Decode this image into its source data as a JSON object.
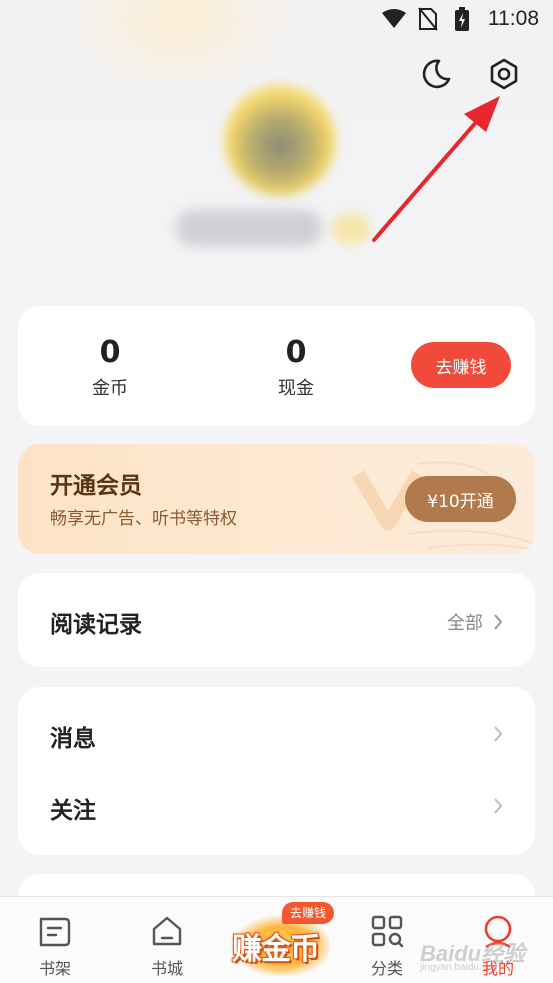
{
  "status_bar": {
    "time": "11:08"
  },
  "wallet": {
    "coins_value": "0",
    "coins_label": "金币",
    "cash_value": "0",
    "cash_label": "现金",
    "earn_button": "去赚钱"
  },
  "vip": {
    "title": "开通会员",
    "subtitle": "畅享无广告、听书等特权",
    "button": "¥10开通"
  },
  "reading": {
    "title": "阅读记录",
    "all_label": "全部"
  },
  "menu": {
    "items": [
      {
        "label": "消息"
      },
      {
        "label": "关注"
      }
    ]
  },
  "bottom_nav": {
    "items": [
      {
        "label": "书架",
        "icon": "bookshelf-icon"
      },
      {
        "label": "书城",
        "icon": "home-icon"
      },
      {
        "label": "分类",
        "icon": "category-icon"
      },
      {
        "label": "我的",
        "icon": "profile-icon",
        "active": true
      }
    ],
    "promo": {
      "text": "赚金币",
      "badge": "去赚钱"
    }
  },
  "watermark": {
    "text": "Baidu经验",
    "sub": "jingyan.baidu.com"
  },
  "colors": {
    "accent": "#f24a3a",
    "vip_button": "#b17a4c",
    "vip_title": "#5b3414",
    "annotation": "#e8262d"
  }
}
